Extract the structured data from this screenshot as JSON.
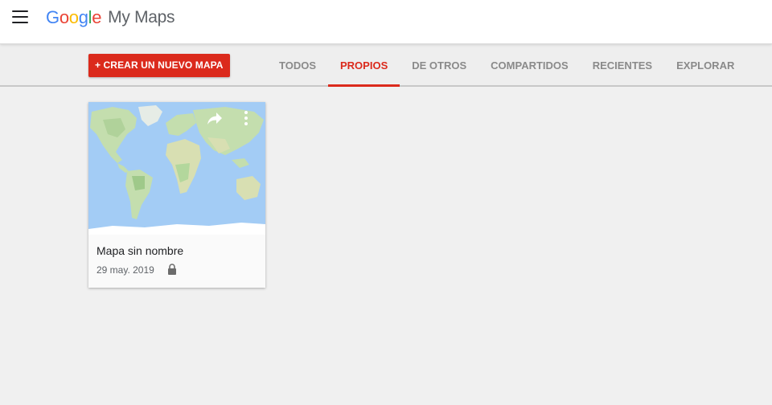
{
  "header": {
    "menu_icon": "hamburger-menu-icon",
    "logo_letters": [
      "G",
      "o",
      "o",
      "g",
      "l",
      "e"
    ],
    "product": "My Maps"
  },
  "toolbar": {
    "create_label": "+ CREAR UN NUEVO MAPA",
    "tabs": [
      {
        "label": "TODOS",
        "active": false
      },
      {
        "label": "PROPIOS",
        "active": true
      },
      {
        "label": "DE OTROS",
        "active": false
      },
      {
        "label": "COMPARTIDOS",
        "active": false
      },
      {
        "label": "RECIENTES",
        "active": false
      },
      {
        "label": "EXPLORAR",
        "active": false
      }
    ]
  },
  "maps": [
    {
      "title": "Mapa sin nombre",
      "date": "29 may. 2019",
      "thumbnail": "world-map-thumbnail",
      "share_icon": "share-icon",
      "more_icon": "more-vert-icon",
      "lock_icon": "lock-icon"
    }
  ],
  "colors": {
    "accent": "#db2a1c",
    "header_bg": "#ffffff",
    "page_bg": "#f0f0f0",
    "tab_inactive": "#8a8a8a",
    "map_ocean": "#a3ccf5",
    "map_land": "#c4deae"
  }
}
